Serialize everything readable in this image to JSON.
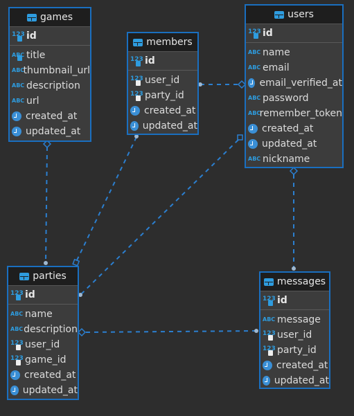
{
  "tables": {
    "games": {
      "name": "games",
      "pk": {
        "name": "id",
        "type": "num"
      },
      "columns": [
        {
          "name": "title",
          "type": "abc",
          "key": "unique"
        },
        {
          "name": "thumbnail_url",
          "type": "abc"
        },
        {
          "name": "description",
          "type": "abc"
        },
        {
          "name": "url",
          "type": "abc"
        },
        {
          "name": "created_at",
          "type": "clock"
        },
        {
          "name": "updated_at",
          "type": "clock"
        }
      ]
    },
    "members": {
      "name": "members",
      "pk": {
        "name": "id",
        "type": "num"
      },
      "columns": [
        {
          "name": "user_id",
          "type": "num",
          "key": "fk"
        },
        {
          "name": "party_id",
          "type": "num",
          "key": "fk"
        },
        {
          "name": "created_at",
          "type": "clock"
        },
        {
          "name": "updated_at",
          "type": "clock"
        }
      ]
    },
    "users": {
      "name": "users",
      "pk": {
        "name": "id",
        "type": "num"
      },
      "columns": [
        {
          "name": "name",
          "type": "abc"
        },
        {
          "name": "email",
          "type": "abc"
        },
        {
          "name": "email_verified_at",
          "type": "clock"
        },
        {
          "name": "password",
          "type": "abc"
        },
        {
          "name": "remember_token",
          "type": "abc"
        },
        {
          "name": "created_at",
          "type": "clock"
        },
        {
          "name": "updated_at",
          "type": "clock"
        },
        {
          "name": "nickname",
          "type": "abc"
        }
      ]
    },
    "parties": {
      "name": "parties",
      "pk": {
        "name": "id",
        "type": "num"
      },
      "columns": [
        {
          "name": "name",
          "type": "abc"
        },
        {
          "name": "description",
          "type": "abc"
        },
        {
          "name": "user_id",
          "type": "num",
          "key": "fk"
        },
        {
          "name": "game_id",
          "type": "num",
          "key": "fk"
        },
        {
          "name": "created_at",
          "type": "clock"
        },
        {
          "name": "updated_at",
          "type": "clock"
        }
      ]
    },
    "messages": {
      "name": "messages",
      "pk": {
        "name": "id",
        "type": "num"
      },
      "columns": [
        {
          "name": "message",
          "type": "abc"
        },
        {
          "name": "user_id",
          "type": "num",
          "key": "fk"
        },
        {
          "name": "party_id",
          "type": "num",
          "key": "fk"
        },
        {
          "name": "created_at",
          "type": "clock"
        },
        {
          "name": "updated_at",
          "type": "clock"
        }
      ]
    }
  },
  "relationships": [
    {
      "from": "parties",
      "to": "games"
    },
    {
      "from": "parties",
      "to": "members"
    },
    {
      "from": "members",
      "to": "users"
    },
    {
      "from": "parties",
      "to": "users"
    },
    {
      "from": "messages",
      "to": "users"
    },
    {
      "from": "messages",
      "to": "parties"
    }
  ],
  "colors": {
    "background": "#2d2d2d",
    "border": "#1a6fc0",
    "link": "#2b7fd0",
    "icon": "#2e9cdf"
  }
}
